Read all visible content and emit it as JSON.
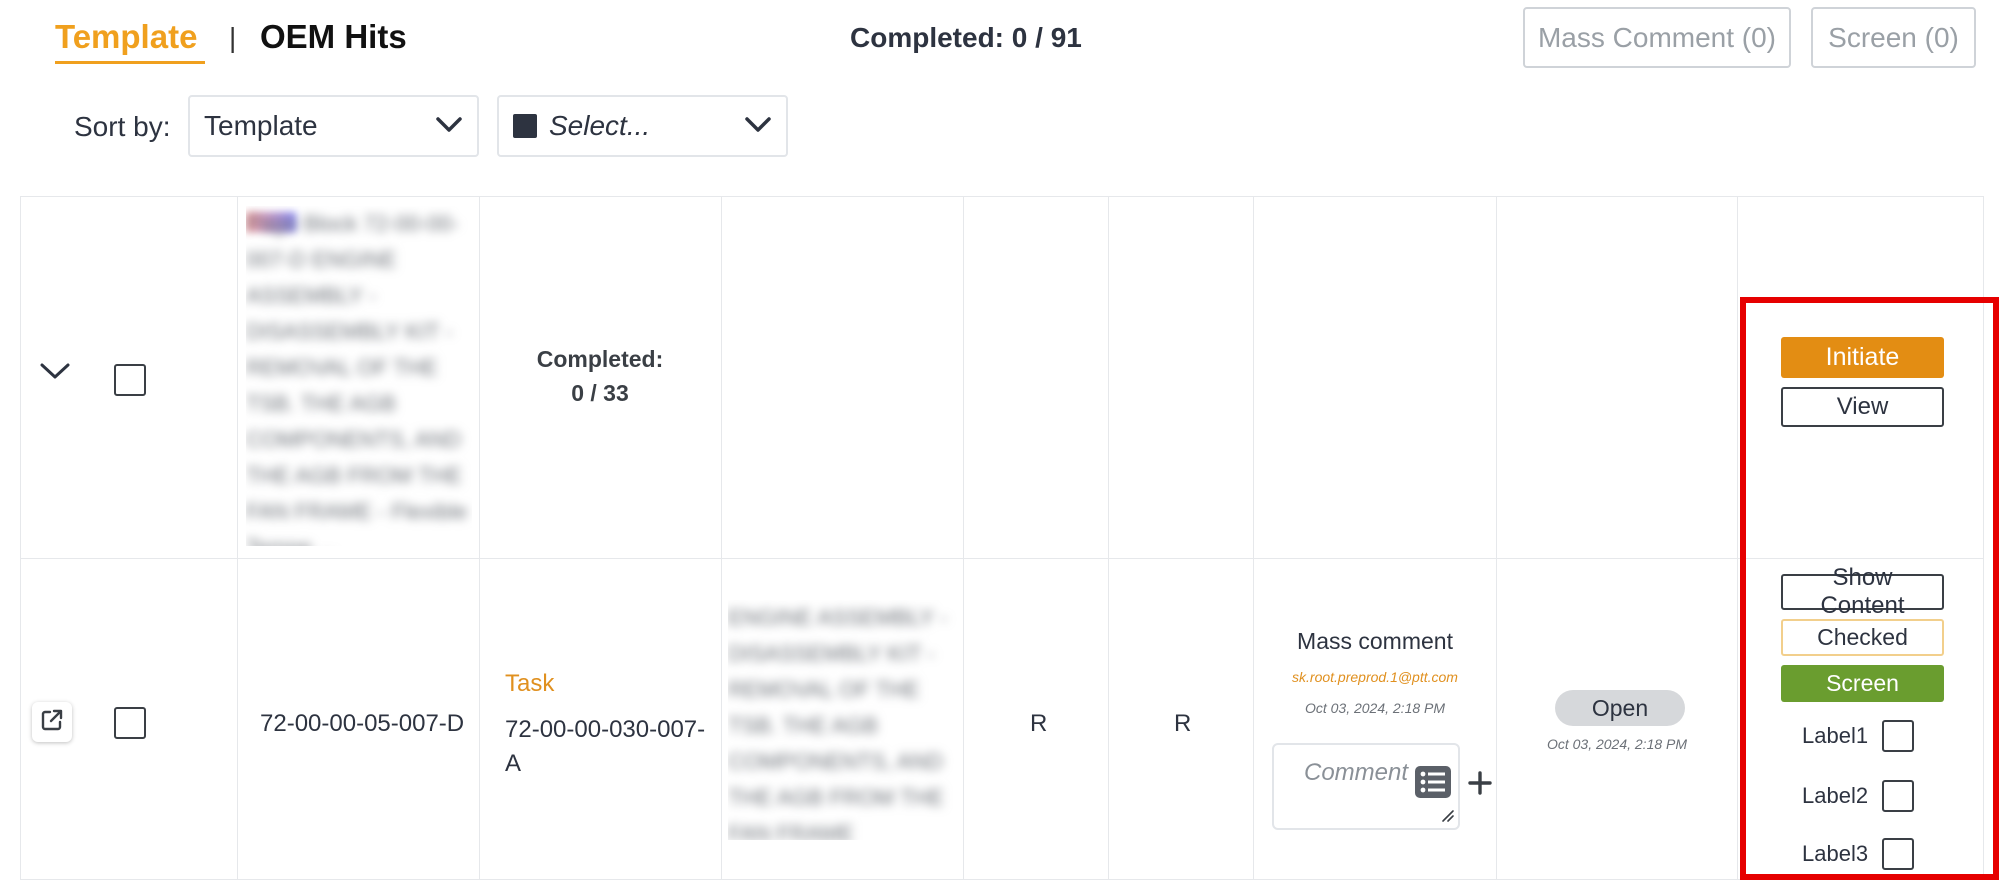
{
  "header": {
    "tabs": [
      {
        "label": "Template",
        "active": true
      },
      {
        "label": "OEM Hits",
        "active": false
      }
    ],
    "separator": "|",
    "completed": "Completed: 0 / 91",
    "mass_comment_button": "Mass Comment (0)",
    "screen_button": "Screen (0)"
  },
  "sort": {
    "label": "Sort by:",
    "selected": "Template",
    "filter_placeholder": "Select..."
  },
  "group_row": {
    "blurred_title": "Page Block 72-00-00-007-D ENGINE ASSEMBLY - DISASSEMBLY KIT - REMOVAL OF THE TSB. THE AGB COMPONENTS, AND THE AGB FROM THE FAN FRAME - Flexible Tempe ...",
    "completed_label": "Completed:",
    "completed_value": "0 / 33",
    "actions": {
      "initiate": "Initiate",
      "view": "View"
    }
  },
  "item_row": {
    "doc_number": "72-00-00-05-007-D",
    "task_label": "Task",
    "task_number": "72-00-00-030-007-A",
    "blurred_desc": "ENGINE ASSEMBLY - DISASSEMBLY KIT - REMOVAL OF THE TSB. THE AGB COMPONENTS, AND THE AGB FROM THE FAN FRAME",
    "col_r1": "R",
    "col_r2": "R",
    "mass_comment": {
      "title": "Mass comment",
      "email": "sk.root.preprod.1@ptt.com",
      "date": "Oct 03, 2024, 2:18 PM",
      "comment_placeholder": "Comment ."
    },
    "status": {
      "label": "Open",
      "date": "Oct 03, 2024, 2:18 PM"
    },
    "actions": {
      "show_content": "Show Content",
      "checked": "Checked",
      "screen": "Screen",
      "labels": [
        "Label1",
        "Label2",
        "Label3"
      ]
    }
  },
  "colors": {
    "accent": "#f0a01e",
    "initiate": "#e38d13",
    "screen": "#6a9d2f",
    "highlight": "#e60000"
  }
}
